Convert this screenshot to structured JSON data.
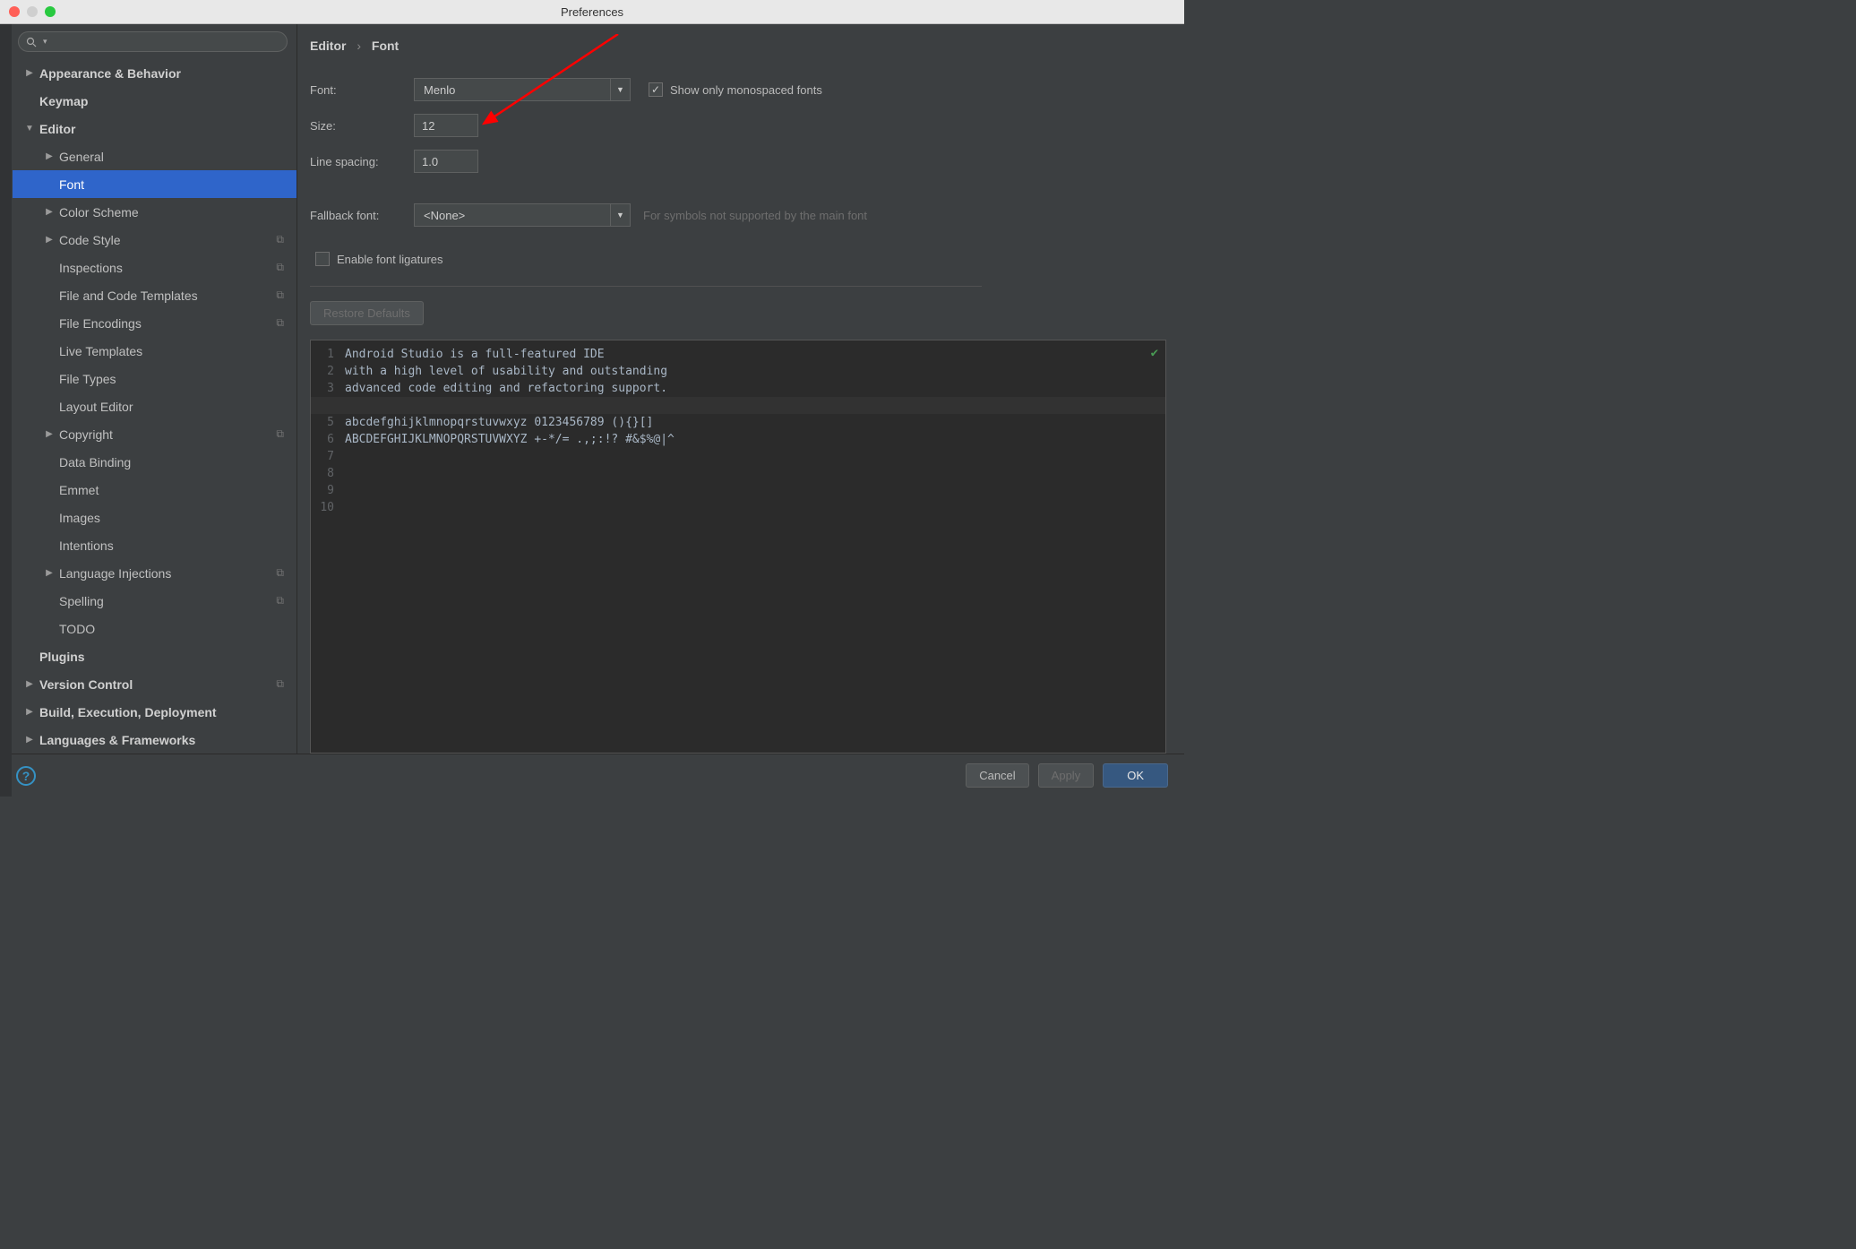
{
  "window": {
    "title": "Preferences"
  },
  "sidebar": {
    "search_placeholder": "",
    "items": [
      {
        "label": "Appearance & Behavior",
        "arrow": "▶",
        "bold": true
      },
      {
        "label": "Keymap",
        "arrow": "",
        "bold": true
      },
      {
        "label": "Editor",
        "arrow": "▼",
        "bold": true
      },
      {
        "label": "General",
        "arrow": "▶",
        "lvl": 2
      },
      {
        "label": "Font",
        "arrow": "",
        "lvl": 2,
        "selected": true
      },
      {
        "label": "Color Scheme",
        "arrow": "▶",
        "lvl": 2
      },
      {
        "label": "Code Style",
        "arrow": "▶",
        "lvl": 2,
        "copy": true
      },
      {
        "label": "Inspections",
        "arrow": "",
        "lvl": 2,
        "copy": true
      },
      {
        "label": "File and Code Templates",
        "arrow": "",
        "lvl": 2,
        "copy": true
      },
      {
        "label": "File Encodings",
        "arrow": "",
        "lvl": 2,
        "copy": true
      },
      {
        "label": "Live Templates",
        "arrow": "",
        "lvl": 2
      },
      {
        "label": "File Types",
        "arrow": "",
        "lvl": 2
      },
      {
        "label": "Layout Editor",
        "arrow": "",
        "lvl": 2
      },
      {
        "label": "Copyright",
        "arrow": "▶",
        "lvl": 2,
        "copy": true
      },
      {
        "label": "Data Binding",
        "arrow": "",
        "lvl": 2
      },
      {
        "label": "Emmet",
        "arrow": "",
        "lvl": 2
      },
      {
        "label": "Images",
        "arrow": "",
        "lvl": 2
      },
      {
        "label": "Intentions",
        "arrow": "",
        "lvl": 2
      },
      {
        "label": "Language Injections",
        "arrow": "▶",
        "lvl": 2,
        "copy": true
      },
      {
        "label": "Spelling",
        "arrow": "",
        "lvl": 2,
        "copy": true
      },
      {
        "label": "TODO",
        "arrow": "",
        "lvl": 2
      },
      {
        "label": "Plugins",
        "arrow": "",
        "bold": true
      },
      {
        "label": "Version Control",
        "arrow": "▶",
        "bold": true,
        "copy": true
      },
      {
        "label": "Build, Execution, Deployment",
        "arrow": "▶",
        "bold": true
      },
      {
        "label": "Languages & Frameworks",
        "arrow": "▶",
        "bold": true
      }
    ]
  },
  "breadcrumb": {
    "root": "Editor",
    "leaf": "Font"
  },
  "form": {
    "font_label": "Font:",
    "font_value": "Menlo",
    "size_label": "Size:",
    "size_value": "12",
    "line_spacing_label": "Line spacing:",
    "line_spacing_value": "1.0",
    "show_monospaced_label": "Show only monospaced fonts",
    "show_monospaced_checked": true,
    "fallback_label": "Fallback font:",
    "fallback_value": "<None>",
    "fallback_hint": "For symbols not supported by the main font",
    "ligatures_label": "Enable font ligatures",
    "ligatures_checked": false,
    "restore_label": "Restore Defaults"
  },
  "preview": {
    "lines": [
      "Android Studio is a full-featured IDE",
      "with a high level of usability and outstanding",
      "advanced code editing and refactoring support.",
      "",
      "abcdefghijklmnopqrstuvwxyz 0123456789 (){}[]",
      "ABCDEFGHIJKLMNOPQRSTUVWXYZ +-*/= .,;:!? #&$%@|^",
      "",
      "",
      "",
      ""
    ]
  },
  "footer": {
    "cancel": "Cancel",
    "apply": "Apply",
    "ok": "OK"
  }
}
